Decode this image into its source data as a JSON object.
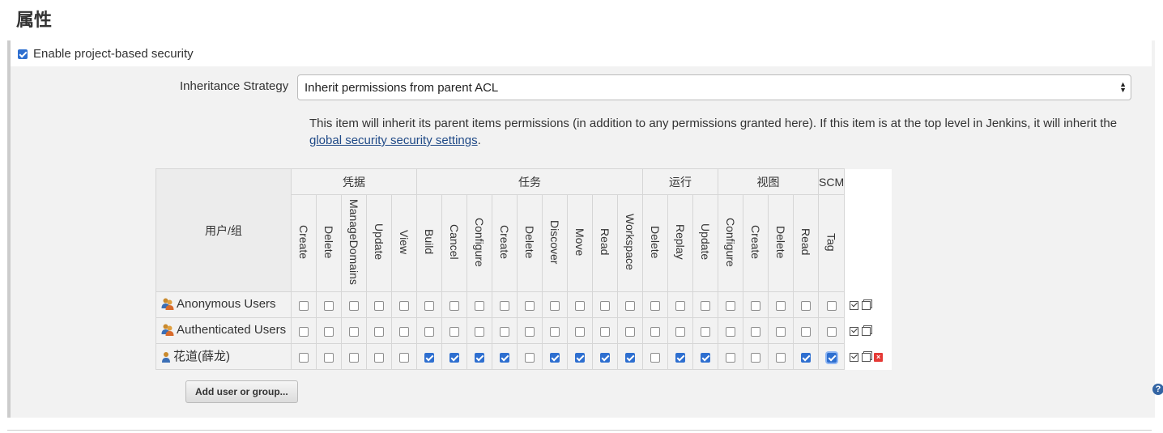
{
  "section": {
    "title": "属性"
  },
  "enable": {
    "label": "Enable project-based security",
    "checked": true
  },
  "strategy": {
    "label": "Inheritance Strategy",
    "selected": "Inherit permissions from parent ACL",
    "help_text": "This item will inherit its parent items permissions (in addition to any permissions granted here). If this item is at the top level in Jenkins, it will inherit the ",
    "help_link": "global security security settings",
    "help_end": "."
  },
  "matrix": {
    "user_column_header": "用户/组",
    "groups": [
      {
        "label": "凭据",
        "perms": [
          "Create",
          "Delete",
          "ManageDomains",
          "Update",
          "View"
        ]
      },
      {
        "label": "任务",
        "perms": [
          "Build",
          "Cancel",
          "Configure",
          "Create",
          "Delete",
          "Discover",
          "Move",
          "Read",
          "Workspace"
        ]
      },
      {
        "label": "运行",
        "perms": [
          "Delete",
          "Replay",
          "Update"
        ]
      },
      {
        "label": "视图",
        "perms": [
          "Configure",
          "Create",
          "Delete",
          "Read"
        ]
      },
      {
        "label": "SCM",
        "perms": [
          "Tag"
        ]
      }
    ],
    "rows": [
      {
        "name": "Anonymous Users",
        "type": "group-icon",
        "checks": [
          false,
          false,
          false,
          false,
          false,
          false,
          false,
          false,
          false,
          false,
          false,
          false,
          false,
          false,
          false,
          false,
          false,
          false,
          false,
          false,
          false,
          false
        ],
        "actions": [
          "toggle-all-icon",
          "copy-icon"
        ]
      },
      {
        "name": "Authenticated Users",
        "type": "group-icon",
        "checks": [
          false,
          false,
          false,
          false,
          false,
          false,
          false,
          false,
          false,
          false,
          false,
          false,
          false,
          false,
          false,
          false,
          false,
          false,
          false,
          false,
          false,
          false
        ],
        "actions": [
          "toggle-all-icon",
          "copy-icon"
        ]
      },
      {
        "name": "花道(薛龙)",
        "type": "user-icon",
        "checks": [
          false,
          false,
          false,
          false,
          false,
          true,
          true,
          true,
          true,
          false,
          true,
          true,
          true,
          true,
          false,
          true,
          true,
          false,
          false,
          false,
          true,
          true
        ],
        "actions": [
          "toggle-all-icon",
          "copy-icon",
          "delete-icon"
        ]
      }
    ]
  },
  "buttons": {
    "add_user": "Add user or group..."
  },
  "help_icon": "?",
  "colors": {
    "checkbox_checked": "#2e6fd0",
    "link": "#204a87",
    "panel_bg": "#f2f2f2"
  }
}
